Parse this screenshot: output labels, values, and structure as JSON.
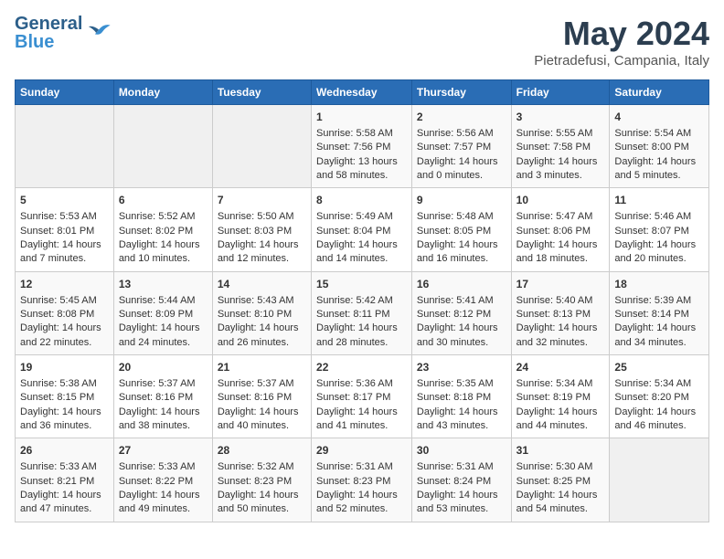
{
  "header": {
    "logo_line1": "General",
    "logo_line2": "Blue",
    "title": "May 2024",
    "subtitle": "Pietradefusi, Campania, Italy"
  },
  "days_of_week": [
    "Sunday",
    "Monday",
    "Tuesday",
    "Wednesday",
    "Thursday",
    "Friday",
    "Saturday"
  ],
  "weeks": [
    [
      {
        "num": "",
        "lines": []
      },
      {
        "num": "",
        "lines": []
      },
      {
        "num": "",
        "lines": []
      },
      {
        "num": "1",
        "lines": [
          "Sunrise: 5:58 AM",
          "Sunset: 7:56 PM",
          "Daylight: 13 hours",
          "and 58 minutes."
        ]
      },
      {
        "num": "2",
        "lines": [
          "Sunrise: 5:56 AM",
          "Sunset: 7:57 PM",
          "Daylight: 14 hours",
          "and 0 minutes."
        ]
      },
      {
        "num": "3",
        "lines": [
          "Sunrise: 5:55 AM",
          "Sunset: 7:58 PM",
          "Daylight: 14 hours",
          "and 3 minutes."
        ]
      },
      {
        "num": "4",
        "lines": [
          "Sunrise: 5:54 AM",
          "Sunset: 8:00 PM",
          "Daylight: 14 hours",
          "and 5 minutes."
        ]
      }
    ],
    [
      {
        "num": "5",
        "lines": [
          "Sunrise: 5:53 AM",
          "Sunset: 8:01 PM",
          "Daylight: 14 hours",
          "and 7 minutes."
        ]
      },
      {
        "num": "6",
        "lines": [
          "Sunrise: 5:52 AM",
          "Sunset: 8:02 PM",
          "Daylight: 14 hours",
          "and 10 minutes."
        ]
      },
      {
        "num": "7",
        "lines": [
          "Sunrise: 5:50 AM",
          "Sunset: 8:03 PM",
          "Daylight: 14 hours",
          "and 12 minutes."
        ]
      },
      {
        "num": "8",
        "lines": [
          "Sunrise: 5:49 AM",
          "Sunset: 8:04 PM",
          "Daylight: 14 hours",
          "and 14 minutes."
        ]
      },
      {
        "num": "9",
        "lines": [
          "Sunrise: 5:48 AM",
          "Sunset: 8:05 PM",
          "Daylight: 14 hours",
          "and 16 minutes."
        ]
      },
      {
        "num": "10",
        "lines": [
          "Sunrise: 5:47 AM",
          "Sunset: 8:06 PM",
          "Daylight: 14 hours",
          "and 18 minutes."
        ]
      },
      {
        "num": "11",
        "lines": [
          "Sunrise: 5:46 AM",
          "Sunset: 8:07 PM",
          "Daylight: 14 hours",
          "and 20 minutes."
        ]
      }
    ],
    [
      {
        "num": "12",
        "lines": [
          "Sunrise: 5:45 AM",
          "Sunset: 8:08 PM",
          "Daylight: 14 hours",
          "and 22 minutes."
        ]
      },
      {
        "num": "13",
        "lines": [
          "Sunrise: 5:44 AM",
          "Sunset: 8:09 PM",
          "Daylight: 14 hours",
          "and 24 minutes."
        ]
      },
      {
        "num": "14",
        "lines": [
          "Sunrise: 5:43 AM",
          "Sunset: 8:10 PM",
          "Daylight: 14 hours",
          "and 26 minutes."
        ]
      },
      {
        "num": "15",
        "lines": [
          "Sunrise: 5:42 AM",
          "Sunset: 8:11 PM",
          "Daylight: 14 hours",
          "and 28 minutes."
        ]
      },
      {
        "num": "16",
        "lines": [
          "Sunrise: 5:41 AM",
          "Sunset: 8:12 PM",
          "Daylight: 14 hours",
          "and 30 minutes."
        ]
      },
      {
        "num": "17",
        "lines": [
          "Sunrise: 5:40 AM",
          "Sunset: 8:13 PM",
          "Daylight: 14 hours",
          "and 32 minutes."
        ]
      },
      {
        "num": "18",
        "lines": [
          "Sunrise: 5:39 AM",
          "Sunset: 8:14 PM",
          "Daylight: 14 hours",
          "and 34 minutes."
        ]
      }
    ],
    [
      {
        "num": "19",
        "lines": [
          "Sunrise: 5:38 AM",
          "Sunset: 8:15 PM",
          "Daylight: 14 hours",
          "and 36 minutes."
        ]
      },
      {
        "num": "20",
        "lines": [
          "Sunrise: 5:37 AM",
          "Sunset: 8:16 PM",
          "Daylight: 14 hours",
          "and 38 minutes."
        ]
      },
      {
        "num": "21",
        "lines": [
          "Sunrise: 5:37 AM",
          "Sunset: 8:16 PM",
          "Daylight: 14 hours",
          "and 40 minutes."
        ]
      },
      {
        "num": "22",
        "lines": [
          "Sunrise: 5:36 AM",
          "Sunset: 8:17 PM",
          "Daylight: 14 hours",
          "and 41 minutes."
        ]
      },
      {
        "num": "23",
        "lines": [
          "Sunrise: 5:35 AM",
          "Sunset: 8:18 PM",
          "Daylight: 14 hours",
          "and 43 minutes."
        ]
      },
      {
        "num": "24",
        "lines": [
          "Sunrise: 5:34 AM",
          "Sunset: 8:19 PM",
          "Daylight: 14 hours",
          "and 44 minutes."
        ]
      },
      {
        "num": "25",
        "lines": [
          "Sunrise: 5:34 AM",
          "Sunset: 8:20 PM",
          "Daylight: 14 hours",
          "and 46 minutes."
        ]
      }
    ],
    [
      {
        "num": "26",
        "lines": [
          "Sunrise: 5:33 AM",
          "Sunset: 8:21 PM",
          "Daylight: 14 hours",
          "and 47 minutes."
        ]
      },
      {
        "num": "27",
        "lines": [
          "Sunrise: 5:33 AM",
          "Sunset: 8:22 PM",
          "Daylight: 14 hours",
          "and 49 minutes."
        ]
      },
      {
        "num": "28",
        "lines": [
          "Sunrise: 5:32 AM",
          "Sunset: 8:23 PM",
          "Daylight: 14 hours",
          "and 50 minutes."
        ]
      },
      {
        "num": "29",
        "lines": [
          "Sunrise: 5:31 AM",
          "Sunset: 8:23 PM",
          "Daylight: 14 hours",
          "and 52 minutes."
        ]
      },
      {
        "num": "30",
        "lines": [
          "Sunrise: 5:31 AM",
          "Sunset: 8:24 PM",
          "Daylight: 14 hours",
          "and 53 minutes."
        ]
      },
      {
        "num": "31",
        "lines": [
          "Sunrise: 5:30 AM",
          "Sunset: 8:25 PM",
          "Daylight: 14 hours",
          "and 54 minutes."
        ]
      },
      {
        "num": "",
        "lines": []
      }
    ]
  ]
}
